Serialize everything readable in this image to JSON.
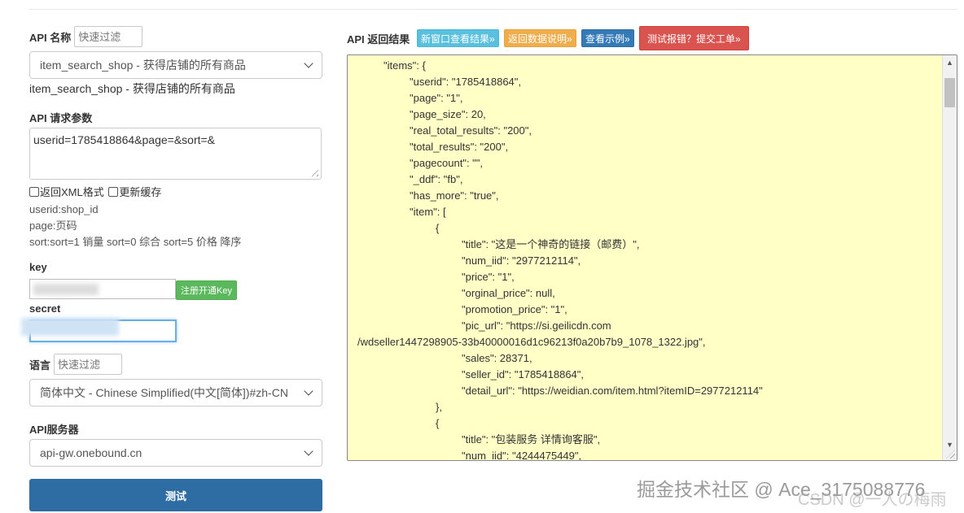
{
  "left": {
    "api_name_label": "API 名称",
    "api_name_filter_placeholder": "快速过滤",
    "api_select_value": "item_search_shop - 获得店铺的所有商品",
    "api_desc": "item_search_shop - 获得店铺的所有商品",
    "params_label": "API 请求参数",
    "params_value": "userid=1785418864&page=&sort=&",
    "opt_xml": "返回XML格式",
    "opt_cache": "更新缓存",
    "hints": [
      "userid:shop_id",
      "page:页码",
      "sort:sort=1 销量 sort=0 综合 sort=5 价格 降序"
    ],
    "key_label": "key",
    "register_key_btn": "注册开通Key",
    "secret_label": "secret",
    "lang_label": "语言",
    "lang_filter_placeholder": "快速过滤",
    "lang_select_value": "简体中文 - Chinese Simplified(中文[简体])#zh-CN",
    "server_label": "API服务器",
    "server_select_value": "api-gw.onebound.cn",
    "test_btn": "测试"
  },
  "right": {
    "title": "API 返回结果",
    "btn_new_window": "新窗口查看结果»",
    "btn_data_desc": "返回数据说明»",
    "btn_example": "查看示例»",
    "btn_report": "测试报错？提交工单»",
    "code_lines": [
      "\"items\": {",
      "\"userid\": \"1785418864\",",
      "\"page\": \"1\",",
      "\"page_size\": 20,",
      "\"real_total_results\": \"200\",",
      "\"total_results\": \"200\",",
      "\"pagecount\": \"\",",
      "\"_ddf\": \"fb\",",
      "\"has_more\": \"true\",",
      "\"item\": [",
      "{",
      "\"title\": \"这是一个神奇的链接（邮费）\",",
      "\"num_iid\": \"2977212114\",",
      "\"price\": \"1\",",
      "\"orginal_price\": null,",
      "\"promotion_price\": \"1\",",
      "\"pic_url\": \"https://si.geilicdn.com",
      "/wdseller1447298905-33b40000016d1c96213f0a20b7b9_1078_1322.jpg\",",
      "\"sales\": 28371,",
      "\"seller_id\": \"1785418864\",",
      "\"detail_url\": \"https://weidian.com/item.html?itemID=2977212114\"",
      "},",
      "{",
      "\"title\": \"包装服务 详情询客服\",",
      "\"num_iid\": \"4244475449\","
    ]
  },
  "watermark": "掘金技术社区 @ Ace_3175088776",
  "watermark2": "CSDN @一人の梅雨"
}
